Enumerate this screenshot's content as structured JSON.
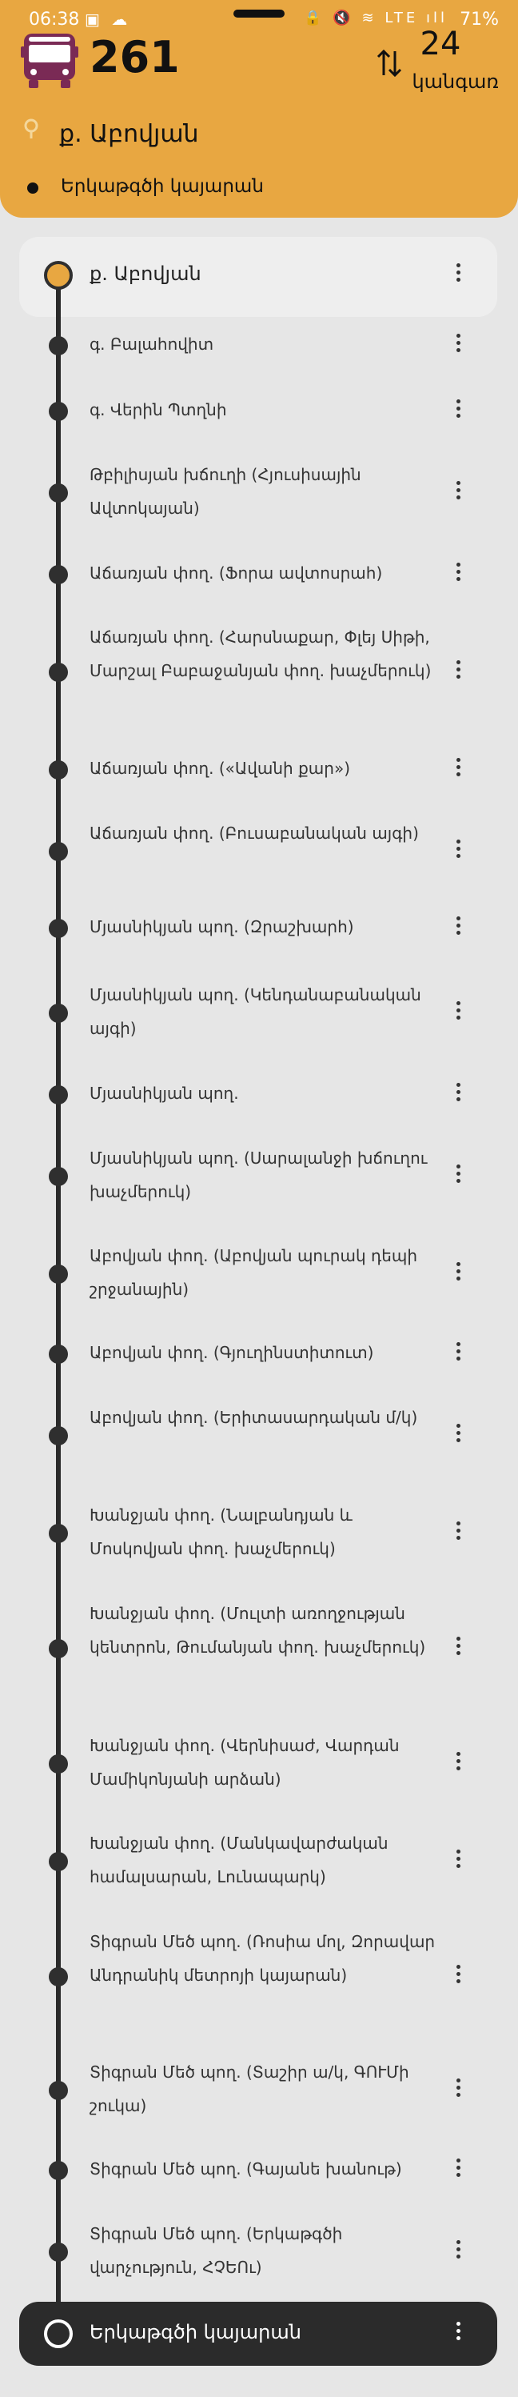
{
  "status_bar": {
    "time": "06:38",
    "left_icons": "▣ ☁",
    "right_icons": "🔒 🔇 ≋ LTE ıll",
    "battery": "71%"
  },
  "header": {
    "route_number": "261",
    "stop_count": "24",
    "stop_count_label": "կանգառ",
    "origin": "ք. Աբովյան",
    "destination": "Երկաթգծի կայարան",
    "accent_color": "#e8a741"
  },
  "stops": [
    {
      "name": "ք. Աբովյան",
      "lines": 1
    },
    {
      "name": "գ. Բալահովիտ",
      "lines": 1
    },
    {
      "name": "գ. Վերին Պտղնի",
      "lines": 1
    },
    {
      "name": "Թբիլիսյան խճուղի (Հյուսիսային Ավտոկայան)",
      "lines": 2
    },
    {
      "name": "Աճառյան փող. (Ֆորա ավտոսրահ)",
      "lines": 1
    },
    {
      "name": "Աճառյան փող. (Հարսնաքար, Փլեյ Սիթի, Մարշալ Բաբաջանյան փող. խաչմերուկ)",
      "lines": 3
    },
    {
      "name": "Աճառյան փող. («Ավանի քար»)",
      "lines": 1
    },
    {
      "name": "Աճառյան փող. (Բուսաբանական այգի)",
      "lines": 2
    },
    {
      "name": "Մյասնիկյան պող. (Զրաշխարհ)",
      "lines": 1
    },
    {
      "name": "Մյասնիկյան պող. (Կենդանաբանական այգի)",
      "lines": 2
    },
    {
      "name": "Մյասնիկյան պող.",
      "lines": 1
    },
    {
      "name": "Մյասնիկյան պող. (Սարալանջի խճուղու խաչմերուկ)",
      "lines": 2
    },
    {
      "name": "Աբովյան փող. (Աբովյան պուրակ դեպի շրջանային)",
      "lines": 2
    },
    {
      "name": "Աբովյան փող. (Գյուղինստիտուտ)",
      "lines": 1
    },
    {
      "name": "Աբովյան փող. (Երիտասարդական մ/կ)",
      "lines": 2
    },
    {
      "name": "Խանջյան փող. (Նալբանդյան և Մոսկովյան փող. խաչմերուկ)",
      "lines": 2
    },
    {
      "name": "Խանջյան փող. (Մուլտի առողջության կենտրոն, Թումանյան փող. խաչմերուկ)",
      "lines": 3
    },
    {
      "name": "Խանջյան փող. (Վերնիսաժ, Վարդան Մամիկոնյանի արձան)",
      "lines": 2
    },
    {
      "name": "Խանջյան փող. (Մանկավարժական համալսարան, Լունապարկ)",
      "lines": 2
    },
    {
      "name": "Տիգրան Մեծ պող. (Ռոսիա մոլ, Զորավար Անդրանիկ մետրոյի կայարան)",
      "lines": 3
    },
    {
      "name": "Տիգրան Մեծ պող. (Տաշիր ա/կ, ԳՈՒՄի շուկա)",
      "lines": 2
    },
    {
      "name": "Տիգրան Մեծ պող. (Գայանե խանութ)",
      "lines": 1
    },
    {
      "name": "Տիգրան Մեծ պող. (Երկաթգծի վարչություն, ՀՉԵՈւ)",
      "lines": 2
    },
    {
      "name": "Երկաթգծի կայարան",
      "lines": 1
    }
  ]
}
